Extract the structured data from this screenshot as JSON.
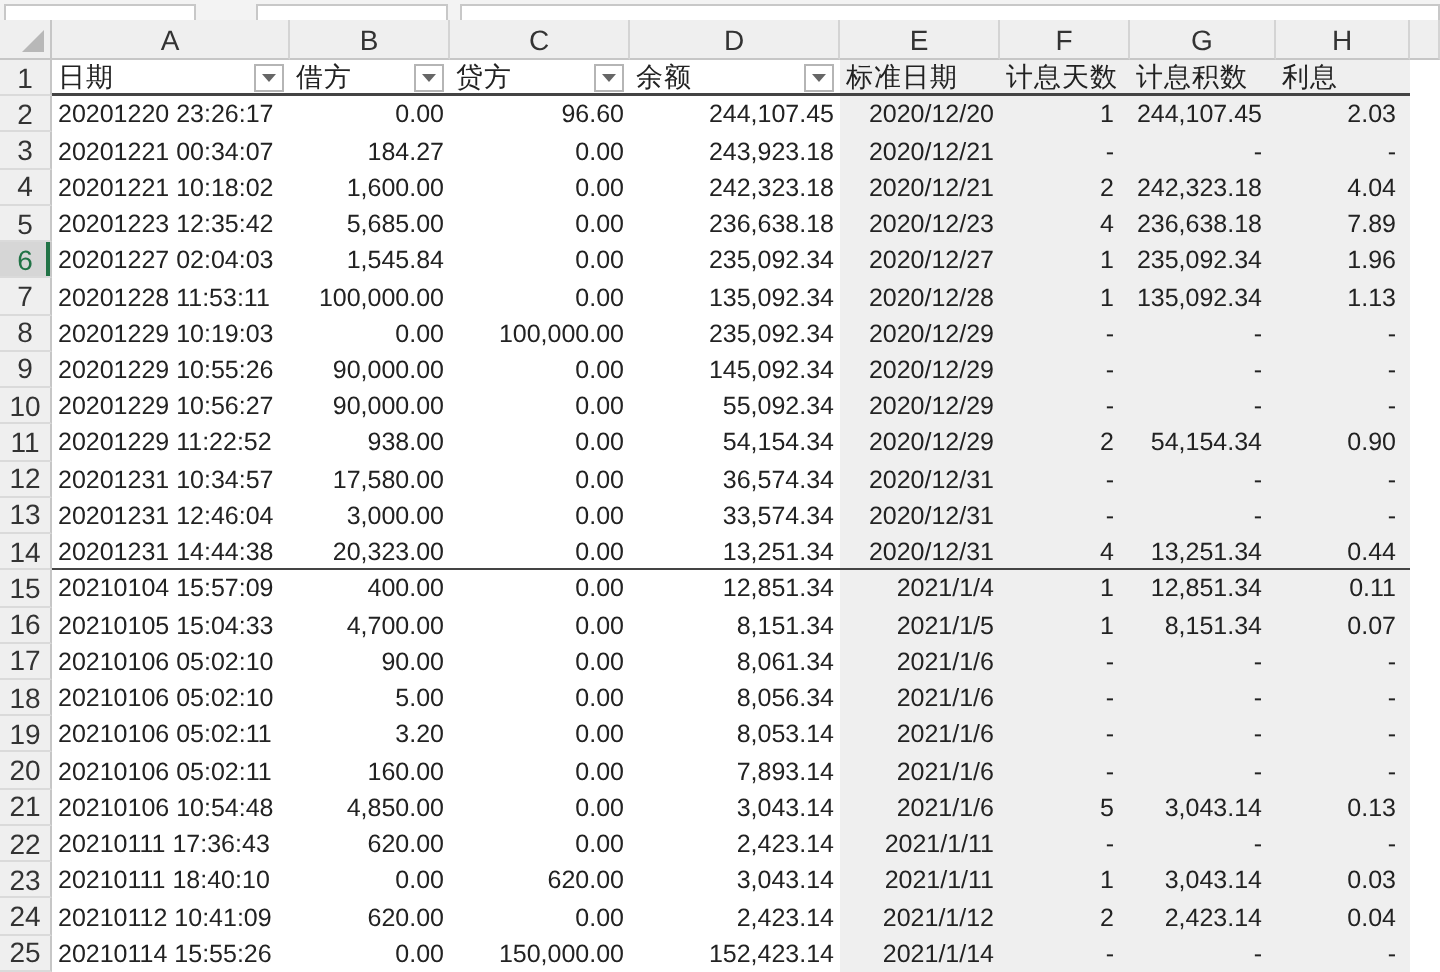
{
  "columns": [
    {
      "letter": "A",
      "title": "日期",
      "filter": true,
      "shaded": false
    },
    {
      "letter": "B",
      "title": "借方",
      "filter": true,
      "shaded": false
    },
    {
      "letter": "C",
      "title": "贷方",
      "filter": true,
      "shaded": false
    },
    {
      "letter": "D",
      "title": "余额",
      "filter": true,
      "shaded": false
    },
    {
      "letter": "E",
      "title": "标准日期",
      "filter": false,
      "shaded": true
    },
    {
      "letter": "F",
      "title": "计息天数",
      "filter": false,
      "shaded": true
    },
    {
      "letter": "G",
      "title": "计息积数",
      "filter": false,
      "shaded": true
    },
    {
      "letter": "H",
      "title": "利息",
      "filter": false,
      "shaded": true
    }
  ],
  "header_row": {
    "number": "1"
  },
  "rows": [
    {
      "number": "2",
      "selected": false,
      "rule_below": false,
      "cells": [
        "20201220 23:26:17",
        "0.00",
        "96.60",
        "244,107.45",
        "2020/12/20",
        "1",
        "244,107.45",
        "2.03"
      ]
    },
    {
      "number": "3",
      "selected": false,
      "rule_below": false,
      "cells": [
        "20201221 00:34:07",
        "184.27",
        "0.00",
        "243,923.18",
        "2020/12/21",
        "-",
        "-",
        "-"
      ]
    },
    {
      "number": "4",
      "selected": false,
      "rule_below": false,
      "cells": [
        "20201221 10:18:02",
        "1,600.00",
        "0.00",
        "242,323.18",
        "2020/12/21",
        "2",
        "242,323.18",
        "4.04"
      ]
    },
    {
      "number": "5",
      "selected": false,
      "rule_below": false,
      "cells": [
        "20201223 12:35:42",
        "5,685.00",
        "0.00",
        "236,638.18",
        "2020/12/23",
        "4",
        "236,638.18",
        "7.89"
      ]
    },
    {
      "number": "6",
      "selected": true,
      "rule_below": false,
      "cells": [
        "20201227 02:04:03",
        "1,545.84",
        "0.00",
        "235,092.34",
        "2020/12/27",
        "1",
        "235,092.34",
        "1.96"
      ]
    },
    {
      "number": "7",
      "selected": false,
      "rule_below": false,
      "cells": [
        "20201228 11:53:11",
        "100,000.00",
        "0.00",
        "135,092.34",
        "2020/12/28",
        "1",
        "135,092.34",
        "1.13"
      ]
    },
    {
      "number": "8",
      "selected": false,
      "rule_below": false,
      "cells": [
        "20201229 10:19:03",
        "0.00",
        "100,000.00",
        "235,092.34",
        "2020/12/29",
        "-",
        "-",
        "-"
      ]
    },
    {
      "number": "9",
      "selected": false,
      "rule_below": false,
      "cells": [
        "20201229 10:55:26",
        "90,000.00",
        "0.00",
        "145,092.34",
        "2020/12/29",
        "-",
        "-",
        "-"
      ]
    },
    {
      "number": "10",
      "selected": false,
      "rule_below": false,
      "cells": [
        "20201229 10:56:27",
        "90,000.00",
        "0.00",
        "55,092.34",
        "2020/12/29",
        "-",
        "-",
        "-"
      ]
    },
    {
      "number": "11",
      "selected": false,
      "rule_below": false,
      "cells": [
        "20201229 11:22:52",
        "938.00",
        "0.00",
        "54,154.34",
        "2020/12/29",
        "2",
        "54,154.34",
        "0.90"
      ]
    },
    {
      "number": "12",
      "selected": false,
      "rule_below": false,
      "cells": [
        "20201231 10:34:57",
        "17,580.00",
        "0.00",
        "36,574.34",
        "2020/12/31",
        "-",
        "-",
        "-"
      ]
    },
    {
      "number": "13",
      "selected": false,
      "rule_below": false,
      "cells": [
        "20201231 12:46:04",
        "3,000.00",
        "0.00",
        "33,574.34",
        "2020/12/31",
        "-",
        "-",
        "-"
      ]
    },
    {
      "number": "14",
      "selected": false,
      "rule_below": true,
      "cells": [
        "20201231 14:44:38",
        "20,323.00",
        "0.00",
        "13,251.34",
        "2020/12/31",
        "4",
        "13,251.34",
        "0.44"
      ]
    },
    {
      "number": "15",
      "selected": false,
      "rule_below": false,
      "cells": [
        "20210104 15:57:09",
        "400.00",
        "0.00",
        "12,851.34",
        "2021/1/4",
        "1",
        "12,851.34",
        "0.11"
      ]
    },
    {
      "number": "16",
      "selected": false,
      "rule_below": false,
      "cells": [
        "20210105 15:04:33",
        "4,700.00",
        "0.00",
        "8,151.34",
        "2021/1/5",
        "1",
        "8,151.34",
        "0.07"
      ]
    },
    {
      "number": "17",
      "selected": false,
      "rule_below": false,
      "cells": [
        "20210106 05:02:10",
        "90.00",
        "0.00",
        "8,061.34",
        "2021/1/6",
        "-",
        "-",
        "-"
      ]
    },
    {
      "number": "18",
      "selected": false,
      "rule_below": false,
      "cells": [
        "20210106 05:02:10",
        "5.00",
        "0.00",
        "8,056.34",
        "2021/1/6",
        "-",
        "-",
        "-"
      ]
    },
    {
      "number": "19",
      "selected": false,
      "rule_below": false,
      "cells": [
        "20210106 05:02:11",
        "3.20",
        "0.00",
        "8,053.14",
        "2021/1/6",
        "-",
        "-",
        "-"
      ]
    },
    {
      "number": "20",
      "selected": false,
      "rule_below": false,
      "cells": [
        "20210106 05:02:11",
        "160.00",
        "0.00",
        "7,893.14",
        "2021/1/6",
        "-",
        "-",
        "-"
      ]
    },
    {
      "number": "21",
      "selected": false,
      "rule_below": false,
      "cells": [
        "20210106 10:54:48",
        "4,850.00",
        "0.00",
        "3,043.14",
        "2021/1/6",
        "5",
        "3,043.14",
        "0.13"
      ]
    },
    {
      "number": "22",
      "selected": false,
      "rule_below": false,
      "cells": [
        "20210111 17:36:43",
        "620.00",
        "0.00",
        "2,423.14",
        "2021/1/11",
        "-",
        "-",
        "-"
      ]
    },
    {
      "number": "23",
      "selected": false,
      "rule_below": false,
      "cells": [
        "20210111 18:40:10",
        "0.00",
        "620.00",
        "3,043.14",
        "2021/1/11",
        "1",
        "3,043.14",
        "0.03"
      ]
    },
    {
      "number": "24",
      "selected": false,
      "rule_below": false,
      "cells": [
        "20210112 10:41:09",
        "620.00",
        "0.00",
        "2,423.14",
        "2021/1/12",
        "2",
        "2,423.14",
        "0.04"
      ]
    },
    {
      "number": "25",
      "selected": false,
      "rule_below": false,
      "cells": [
        "20210114 15:55:26",
        "0.00",
        "150,000.00",
        "152,423.14",
        "2021/1/14",
        "-",
        "-",
        "-"
      ]
    }
  ]
}
